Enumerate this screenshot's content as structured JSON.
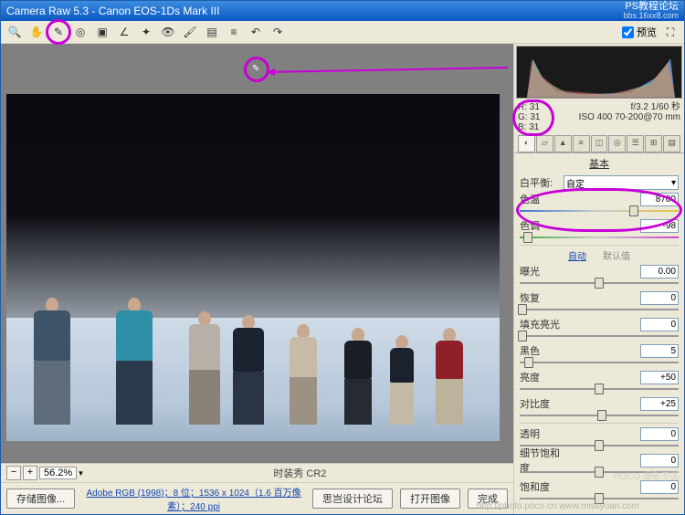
{
  "title": "Camera Raw 5.3  -  Canon EOS-1Ds Mark III",
  "title_right1": "PS教程论坛",
  "title_right2": "bbs.16xx8.com",
  "preview_label": "预览",
  "zoom_level": "56.2%",
  "filename": "时装秀 CR2",
  "save_btn": "存储图像...",
  "color_profile": "Adobe RGB (1998)；8 位；1536 x 1024（1.6 百万像素）；240 ppi",
  "bottom_btn1": "思岂设计论坛",
  "bottom_btn2": "打开图像",
  "bottom_btn3": "完成",
  "rgb": {
    "R": "R:  31",
    "G": "G:  31",
    "B": "B:  31"
  },
  "exif": {
    "line1": "f/3.2  1/60 秒",
    "line2": "ISO 400  70-200@70 mm"
  },
  "panel_name": "基本",
  "wb": {
    "label": "白平衡:",
    "value": "自定"
  },
  "temp": {
    "label": "色温",
    "value": "8700",
    "pos": 72
  },
  "tint": {
    "label": "色调",
    "value": "-98",
    "pos": 5
  },
  "subtab_auto": "自动",
  "subtab_default": "默认值",
  "sliders": [
    {
      "label": "曝光",
      "value": "0.00",
      "pos": 50
    },
    {
      "label": "恢复",
      "value": "0",
      "pos": 2
    },
    {
      "label": "填充亮光",
      "value": "0",
      "pos": 2
    },
    {
      "label": "黑色",
      "value": "5",
      "pos": 6
    },
    {
      "label": "亮度",
      "value": "+50",
      "pos": 50
    },
    {
      "label": "对比度",
      "value": "+25",
      "pos": 52
    }
  ],
  "sliders2": [
    {
      "label": "透明",
      "value": "0",
      "pos": 50
    },
    {
      "label": "细节饱和度",
      "value": "0",
      "pos": 50
    },
    {
      "label": "饱和度",
      "value": "0",
      "pos": 50
    }
  ],
  "watermark": "POCO 摄影专区",
  "watermark2": "http://photo.poco.cn   www.missyuan.com"
}
